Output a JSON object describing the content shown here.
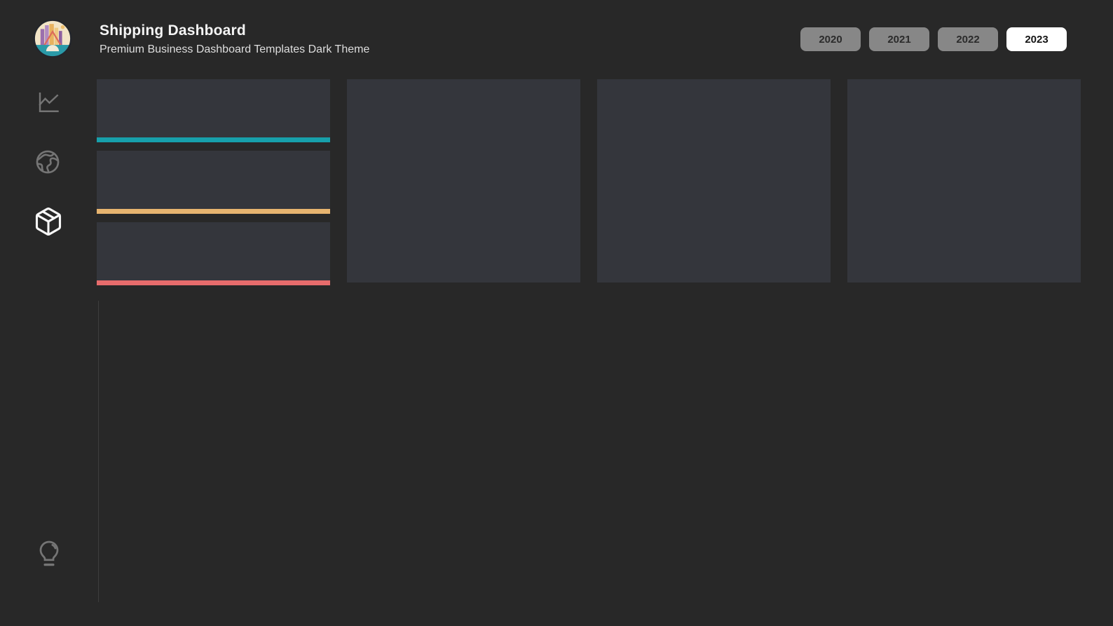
{
  "app": {
    "title": "Shipping Dashboard",
    "subtitle": "Premium Business Dashboard Templates Dark Theme",
    "logo": "city-skyline-badge"
  },
  "year_filter": {
    "options": [
      {
        "label": "2020",
        "selected": false
      },
      {
        "label": "2021",
        "selected": false
      },
      {
        "label": "2022",
        "selected": false
      },
      {
        "label": "2023",
        "selected": true
      }
    ]
  },
  "sidebar": {
    "items": [
      {
        "icon": "line-chart-icon",
        "active": false
      },
      {
        "icon": "globe-icon",
        "active": false
      },
      {
        "icon": "package-icon",
        "active": true
      }
    ],
    "footer_items": [
      {
        "icon": "lightbulb-icon",
        "active": false
      }
    ]
  },
  "kpi_cards": [
    {
      "accent_color": "#17a0ab"
    },
    {
      "accent_color": "#e7b46f"
    },
    {
      "accent_color": "#e76c6c"
    }
  ],
  "chart_panels": [
    {
      "state": "empty"
    },
    {
      "state": "empty"
    },
    {
      "state": "empty"
    }
  ],
  "colors": {
    "background": "#282828",
    "panel": "#34363c",
    "accent_teal": "#17a0ab",
    "accent_sand": "#e7b46f",
    "accent_coral": "#e76c6c",
    "button_gray": "#878787",
    "button_selected": "#ffffff",
    "axis_line": "#3d3d3d",
    "icon_inactive": "#757575",
    "icon_active": "#f8f8f8"
  }
}
